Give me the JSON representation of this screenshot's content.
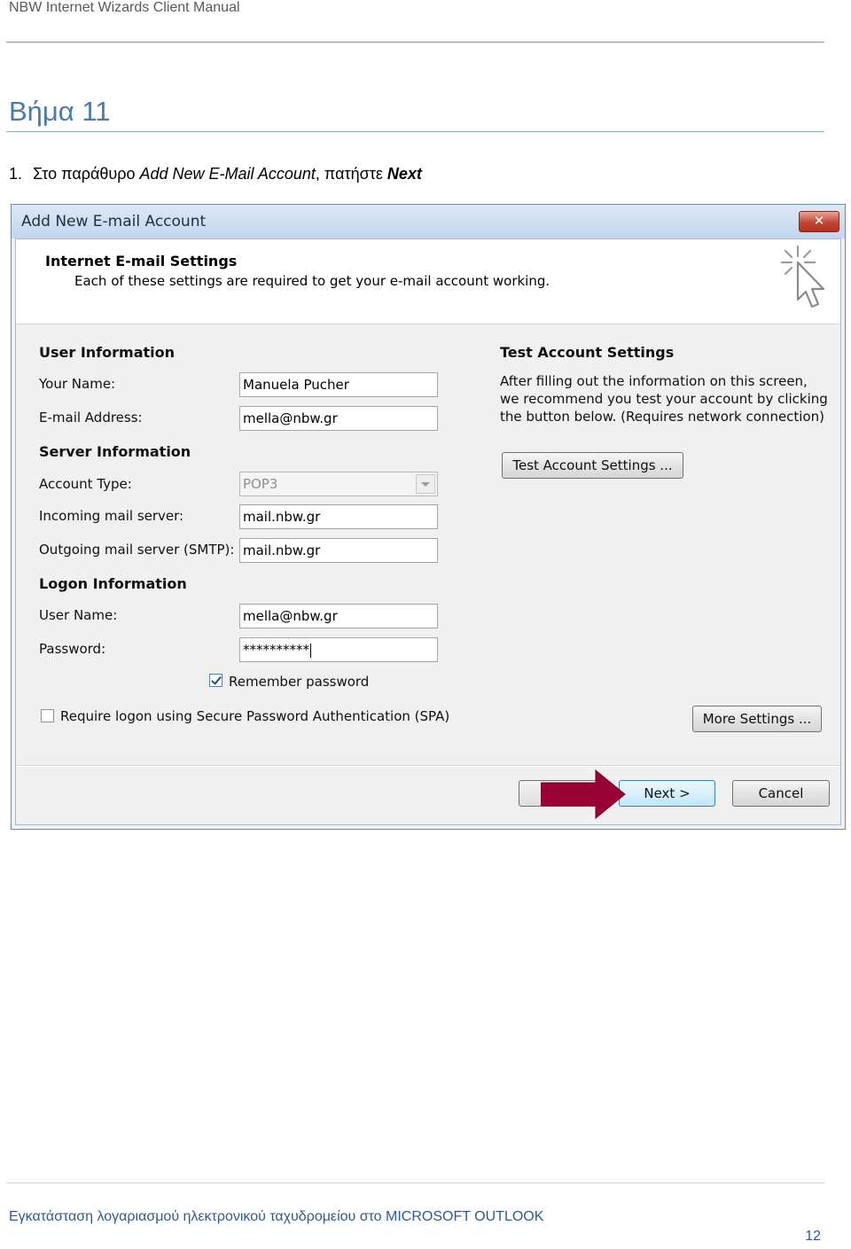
{
  "doc": {
    "header": "NBW Internet Wizards Client Manual",
    "step_title": "Βήμα 11",
    "instruction": {
      "number": "1.",
      "prefix": "Στο παράθυρο ",
      "window_name": "Add New E-Mail Account",
      "middle": ", πατήστε ",
      "button_name": "Next"
    },
    "footer": "Εγκατάσταση λογαριασμού ηλεκτρονικού ταχυδρομείου στο MICROSOFT OUTLOOK",
    "page_number": "12"
  },
  "dialog": {
    "title": "Add New E-mail Account",
    "close_symbol": "✕",
    "banner": {
      "title": "Internet E-mail Settings",
      "subtitle": "Each of these settings are required to get your e-mail account working."
    },
    "user_info": {
      "heading": "User Information",
      "name_label": "Your Name:",
      "name_value": "Manuela Pucher",
      "email_label": "E-mail Address:",
      "email_value": "mella@nbw.gr"
    },
    "server_info": {
      "heading": "Server Information",
      "account_type_label": "Account Type:",
      "account_type_value": "POP3",
      "incoming_label": "Incoming mail server:",
      "incoming_value": "mail.nbw.gr",
      "outgoing_label": "Outgoing mail server (SMTP):",
      "outgoing_value": "mail.nbw.gr"
    },
    "logon_info": {
      "heading": "Logon Information",
      "user_label": "User Name:",
      "user_value": "mella@nbw.gr",
      "password_label": "Password:",
      "password_value": "**********",
      "remember_label": "Remember password",
      "remember_checked": true,
      "spa_label": "Require logon using Secure Password Authentication (SPA)",
      "spa_checked": false
    },
    "test": {
      "heading": "Test Account Settings",
      "description": "After filling out the information on this screen, we recommend you test your account by clicking the button below. (Requires network connection)",
      "button": "Test Account Settings ..."
    },
    "more_settings": "More Settings ...",
    "buttons": {
      "next": "Next >",
      "cancel": "Cancel"
    },
    "colors": {
      "arrow": "#990033",
      "titlebar": "#c2d6ee",
      "close": "#c24532"
    }
  }
}
